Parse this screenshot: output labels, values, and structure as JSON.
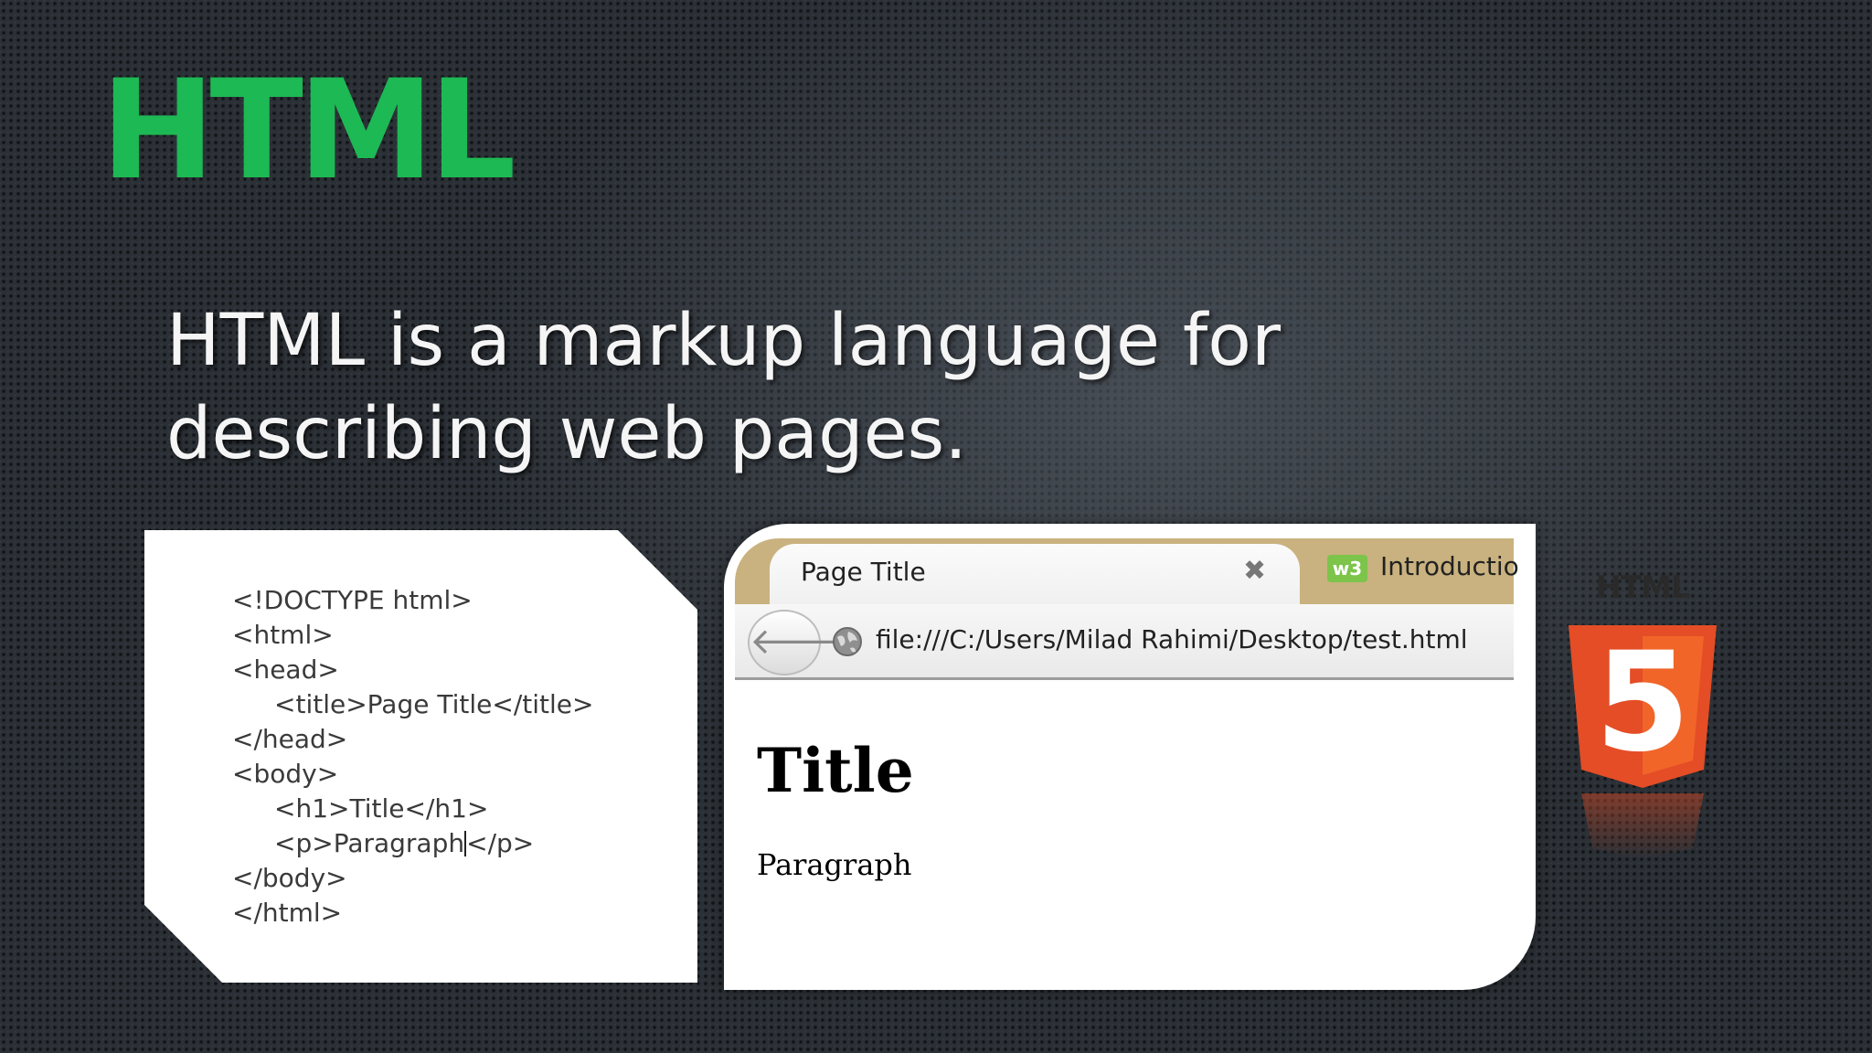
{
  "slide": {
    "title": "HTML",
    "subtitle_line1": "HTML is a markup language for",
    "subtitle_line2": "describing web pages."
  },
  "code_sample": {
    "lines": [
      {
        "text": "<!DOCTYPE html>",
        "indent": false
      },
      {
        "text": "<html>",
        "indent": false
      },
      {
        "text": "<head>",
        "indent": false
      },
      {
        "text": "<title>Page Title</title>",
        "indent": true
      },
      {
        "text": "</head>",
        "indent": false
      },
      {
        "text": "<body>",
        "indent": false
      },
      {
        "text": "<h1>Title</h1>",
        "indent": true
      },
      {
        "text_before_caret": "<p>Paragraph",
        "text_after_caret": "</p>",
        "indent": true
      },
      {
        "text": "</body>",
        "indent": false
      },
      {
        "text": "</html>",
        "indent": false
      }
    ]
  },
  "browser": {
    "active_tab_title": "Page Title",
    "active_tab_close": "✖",
    "second_tab_icon_text": "w3",
    "second_tab_title": "Introductio",
    "back_glyph": "🡐",
    "url": "file:///C:/Users/Milad Rahimi/Desktop/test.html",
    "page_heading": "Title",
    "page_paragraph": "Paragraph"
  },
  "logo": {
    "label": "HTML",
    "digit": "5",
    "colors": {
      "dark": "#e44d26",
      "light": "#f16529",
      "banner": "#2a2a2a"
    }
  },
  "colors": {
    "title_green": "#1db954",
    "tab_strip": "#c9b27f"
  }
}
